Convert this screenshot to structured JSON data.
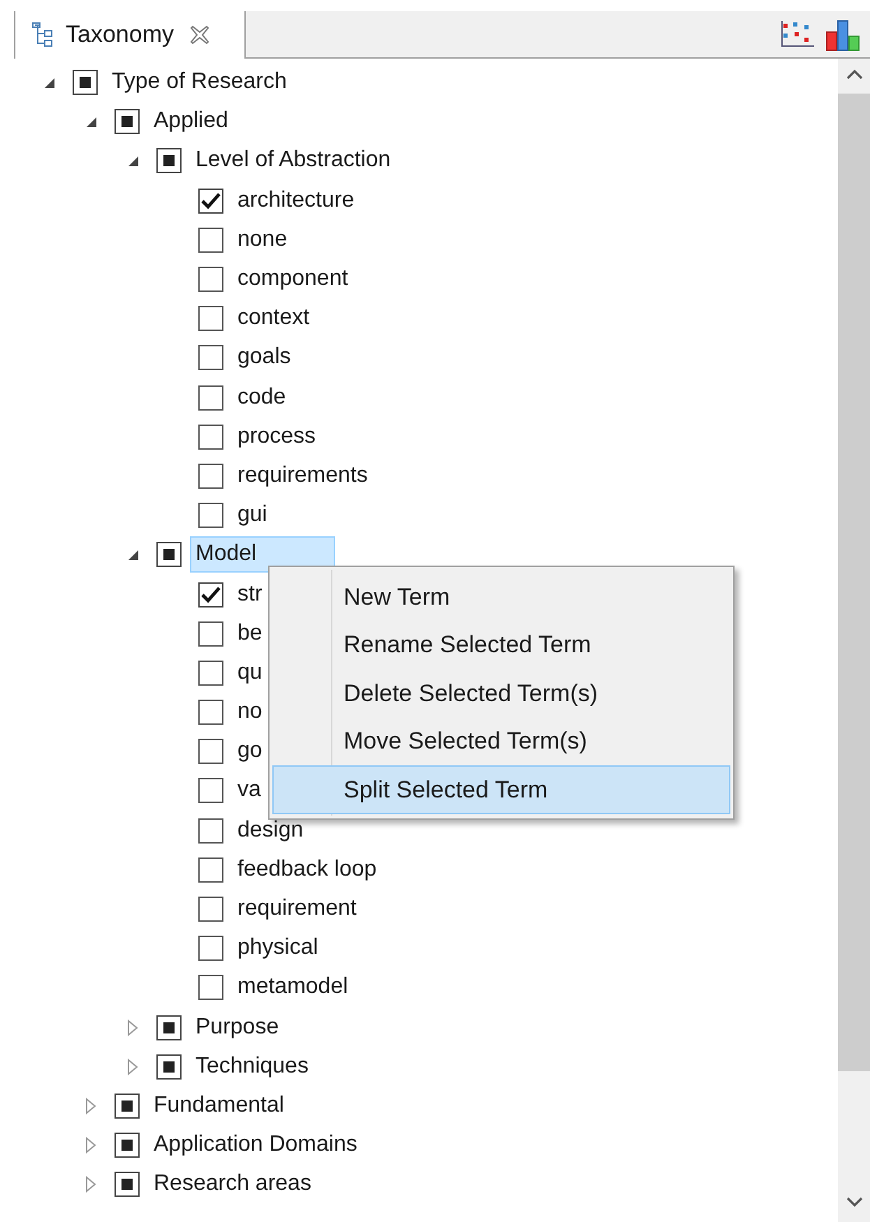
{
  "tab": {
    "title": "Taxonomy",
    "selected": true
  },
  "tree": [
    {
      "label": "Type of Research",
      "partial": true,
      "expanded": true,
      "children": [
        {
          "label": "Applied",
          "partial": true,
          "expanded": true,
          "children": [
            {
              "label": "Level of Abstraction",
              "partial": true,
              "expanded": true,
              "children": [
                {
                  "label": "architecture",
                  "checked": true
                },
                {
                  "label": "none",
                  "checked": false
                },
                {
                  "label": "component",
                  "checked": false
                },
                {
                  "label": "context",
                  "checked": false
                },
                {
                  "label": "goals",
                  "checked": false
                },
                {
                  "label": "code",
                  "checked": false
                },
                {
                  "label": "process",
                  "checked": false
                },
                {
                  "label": "requirements",
                  "checked": false
                },
                {
                  "label": "gui",
                  "checked": false
                }
              ]
            },
            {
              "label": "Model",
              "partial": true,
              "expanded": true,
              "selected": true,
              "children": [
                {
                  "label": "str",
                  "checked": true
                },
                {
                  "label": "be",
                  "checked": false
                },
                {
                  "label": "qu",
                  "checked": false
                },
                {
                  "label": "no",
                  "checked": false
                },
                {
                  "label": "go",
                  "checked": false
                },
                {
                  "label": "va",
                  "checked": false
                },
                {
                  "label": "design",
                  "checked": false
                },
                {
                  "label": "feedback loop",
                  "checked": false
                },
                {
                  "label": "requirement",
                  "checked": false
                },
                {
                  "label": "physical",
                  "checked": false
                },
                {
                  "label": "metamodel",
                  "checked": false
                }
              ]
            },
            {
              "label": "Purpose",
              "partial": true,
              "expanded": false
            },
            {
              "label": "Techniques",
              "partial": true,
              "expanded": false
            }
          ]
        },
        {
          "label": "Fundamental",
          "partial": true,
          "expanded": false
        },
        {
          "label": "Application Domains",
          "partial": true,
          "expanded": false
        },
        {
          "label": "Research areas",
          "partial": true,
          "expanded": false
        }
      ]
    }
  ],
  "context_menu": [
    {
      "label": "New Term",
      "selected": false
    },
    {
      "label": "Rename Selected Term",
      "selected": false
    },
    {
      "label": "Delete Selected Term(s)",
      "selected": false
    },
    {
      "label": "Move Selected Term(s)",
      "selected": false
    },
    {
      "label": "Split Selected Term",
      "selected": true
    }
  ]
}
